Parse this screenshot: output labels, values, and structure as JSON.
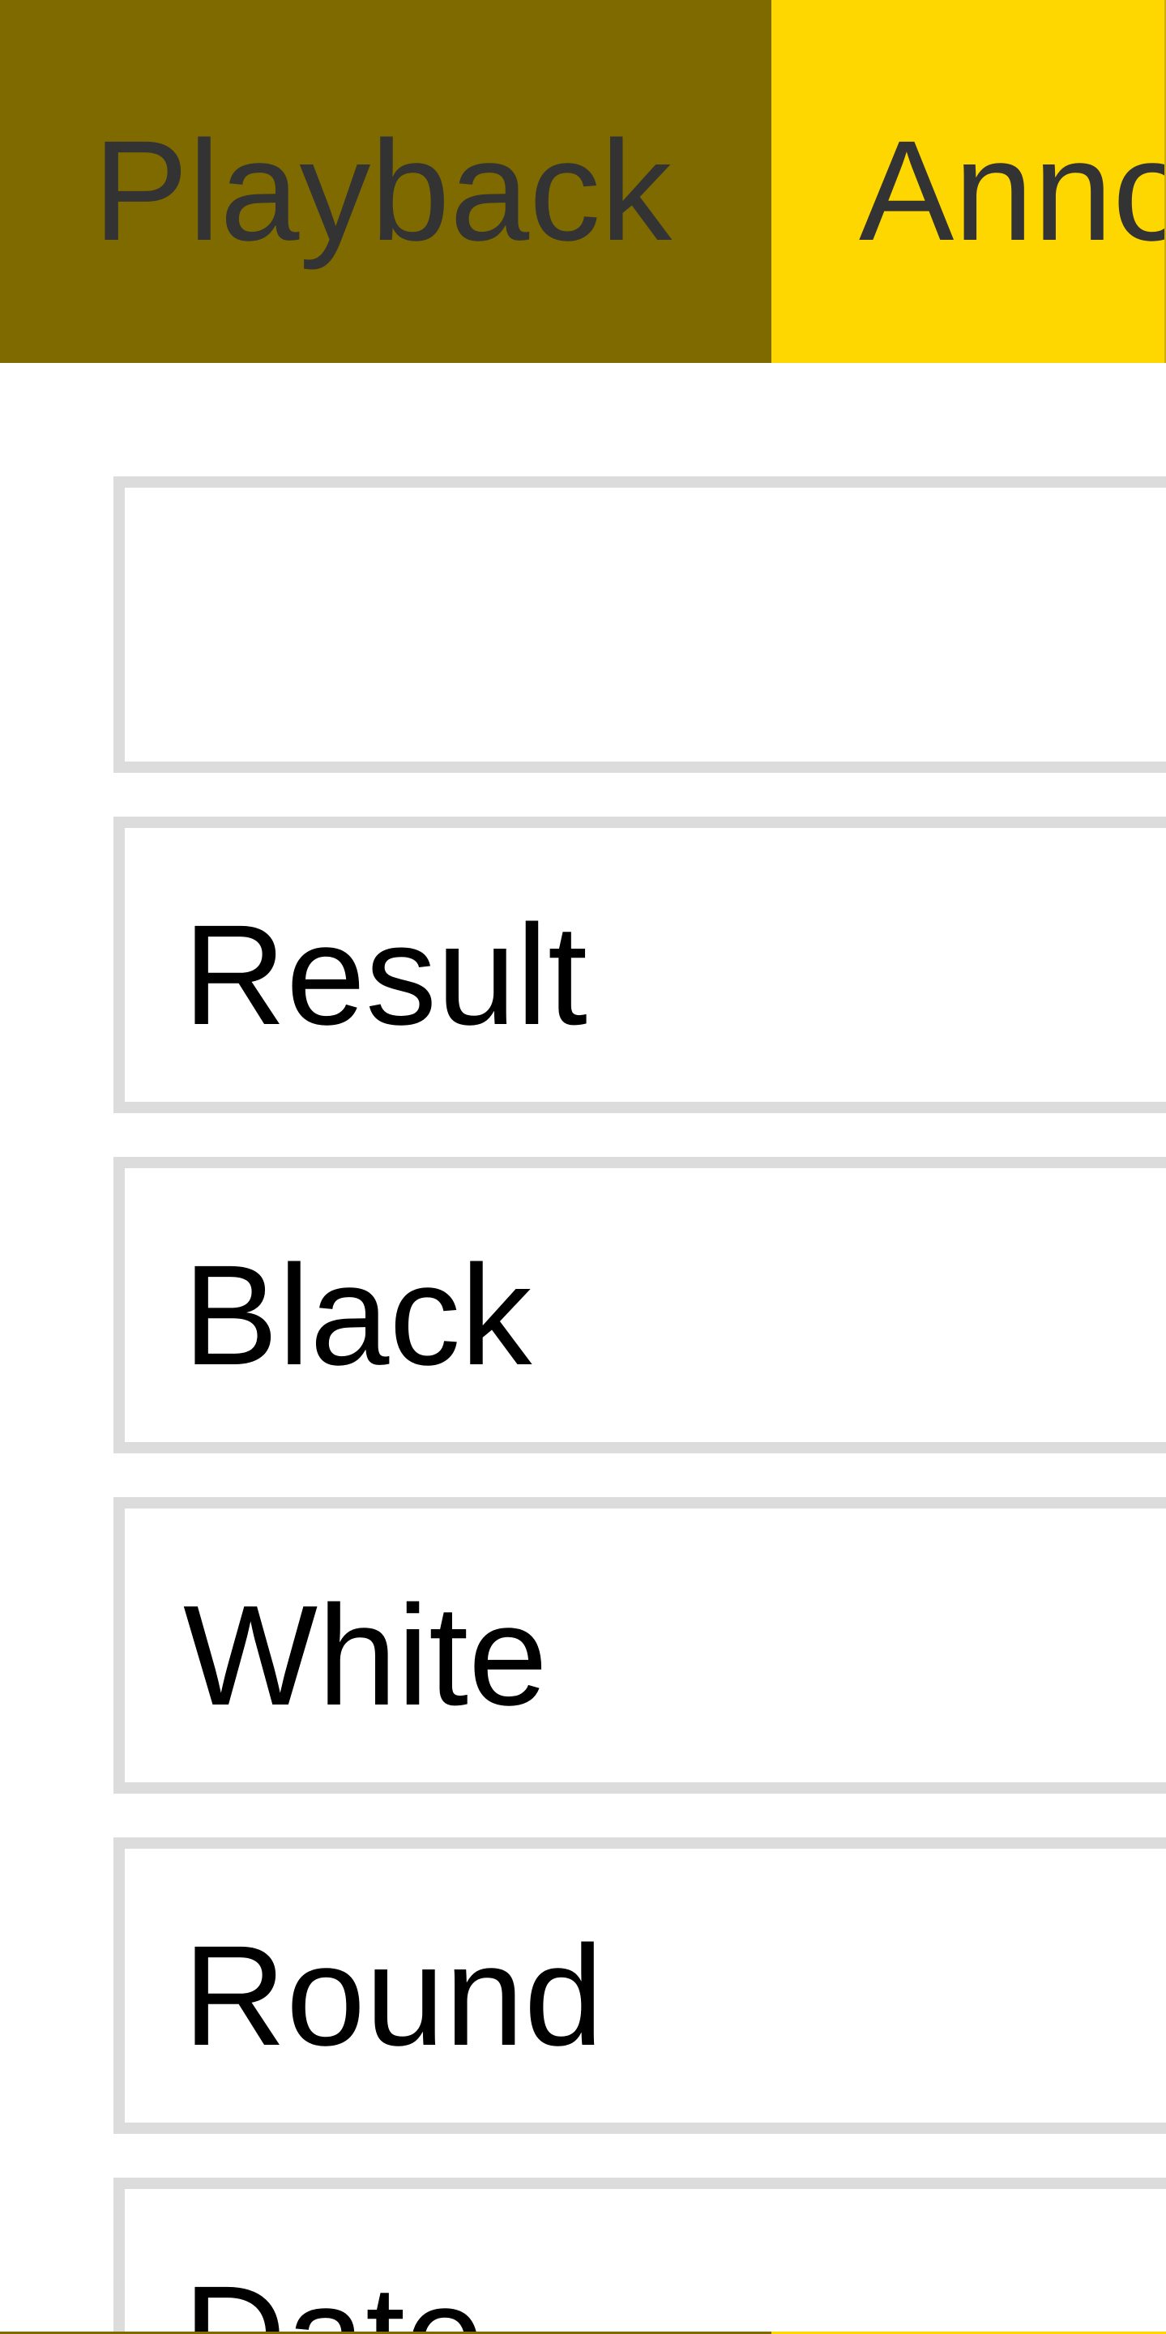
{
  "tabs": [
    {
      "label": "Playback",
      "selected": true
    },
    {
      "label": "Anno",
      "selected": false
    }
  ],
  "colors": {
    "tab_selected_bg": "#7f6a00",
    "tab_unselected_bg": "#ffd700",
    "tab_text": "#333333",
    "field_border": "#dcdcdc",
    "field_text": "#000000"
  },
  "fields": [
    {
      "label": ""
    },
    {
      "label": "Result"
    },
    {
      "label": "Black"
    },
    {
      "label": "White"
    },
    {
      "label": "Round"
    },
    {
      "label": "Date"
    }
  ]
}
